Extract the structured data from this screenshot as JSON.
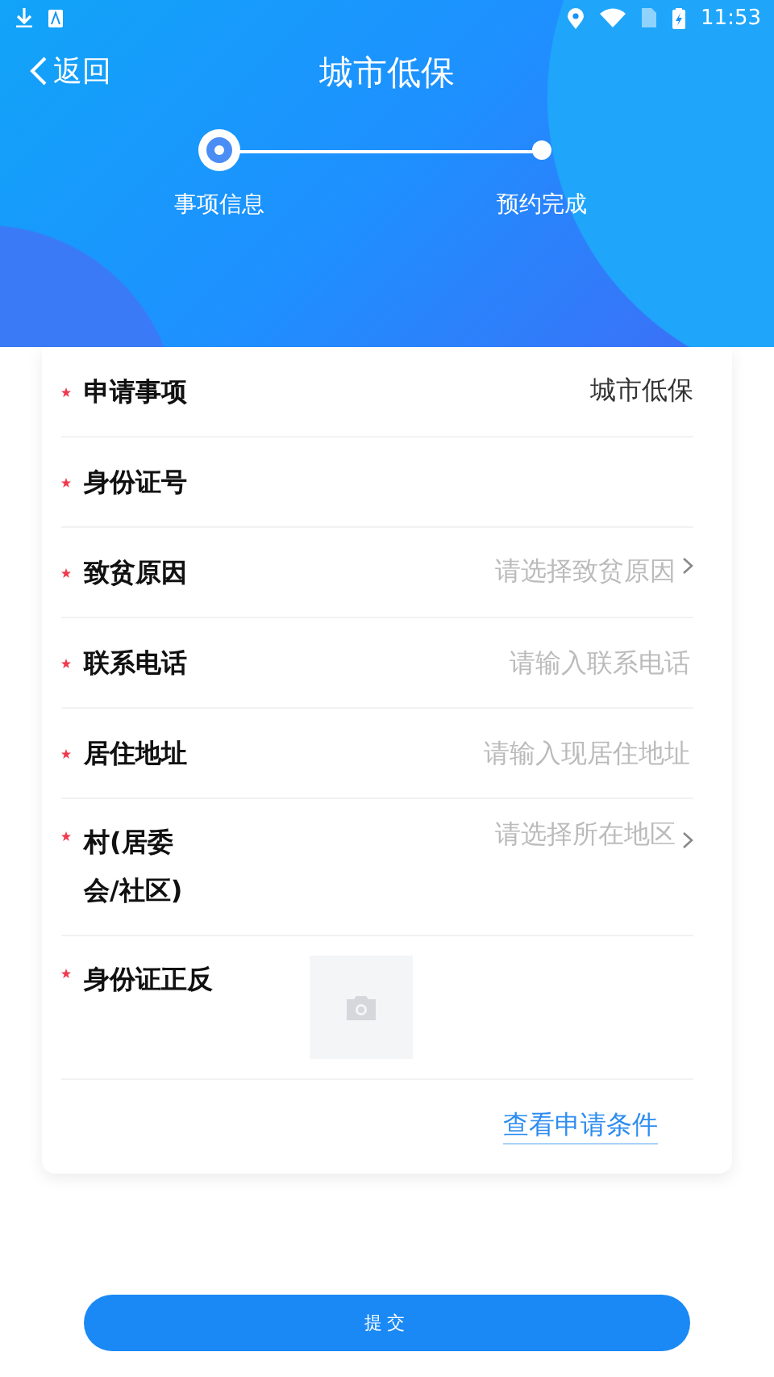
{
  "status_bar": {
    "time": "11:53"
  },
  "header": {
    "back": "返回",
    "title": "城市低保"
  },
  "steps": [
    {
      "label": "事项信息",
      "selected": true
    },
    {
      "label": "预约完成",
      "selected": false
    }
  ],
  "form": {
    "rows": [
      {
        "kind": "value",
        "label": "申请事项",
        "required": true,
        "value": "城市低保"
      },
      {
        "kind": "input",
        "label": "身份证号",
        "required": true
      },
      {
        "kind": "select",
        "label": "致贫原因",
        "required": true,
        "placeholder": "请选择致贫原因"
      },
      {
        "kind": "input",
        "label": "联系电话",
        "required": true,
        "placeholder": "请输入联系电话"
      },
      {
        "kind": "input",
        "label": "居住地址",
        "required": true,
        "placeholder": "请输入现居住地址"
      },
      {
        "kind": "select",
        "label": "村(居委会/社区)",
        "required": true,
        "placeholder": "请选择所在地区"
      },
      {
        "kind": "upload",
        "label": "身份证正反",
        "required": true
      }
    ],
    "link": "查看申请条件"
  },
  "submit": "提交"
}
